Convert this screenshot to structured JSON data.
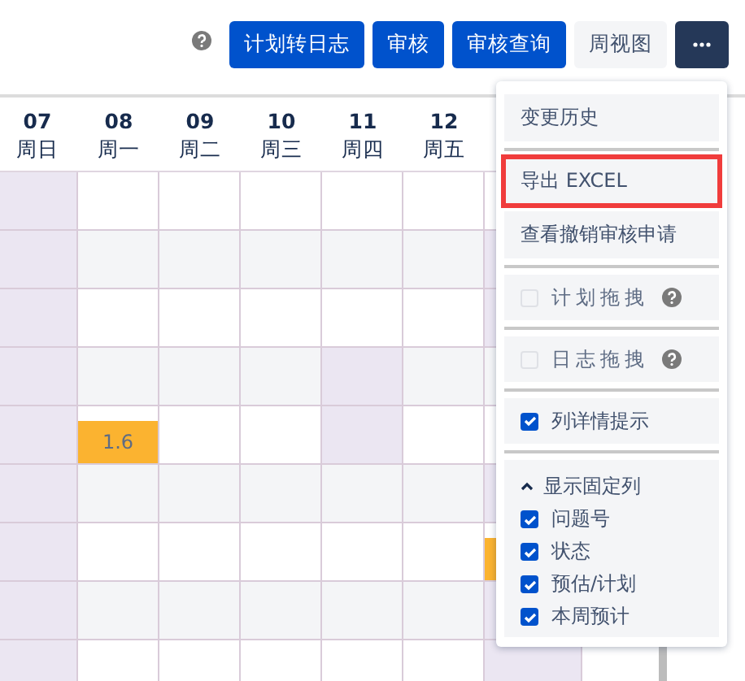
{
  "toolbar": {
    "buttons": [
      {
        "kind": "primary",
        "label": "计划转日志"
      },
      {
        "kind": "primary",
        "label": "审核"
      },
      {
        "kind": "primary",
        "label": "审核查询"
      },
      {
        "kind": "subtle",
        "label": "周视图"
      },
      {
        "kind": "more"
      }
    ]
  },
  "calendar": {
    "days": [
      {
        "date": "07",
        "weekday": "周日"
      },
      {
        "date": "08",
        "weekday": "周一"
      },
      {
        "date": "09",
        "weekday": "周二"
      },
      {
        "date": "10",
        "weekday": "周三"
      },
      {
        "date": "11",
        "weekday": "周四"
      },
      {
        "date": "12",
        "weekday": "周五"
      }
    ],
    "rows": [
      {
        "cells": [
          {
            "kind": "off"
          },
          {
            "kind": "empty"
          },
          {
            "kind": "empty"
          },
          {
            "kind": "empty"
          },
          {
            "kind": "empty"
          },
          {
            "kind": "empty"
          },
          {
            "kind": "empty"
          }
        ]
      },
      {
        "cells": [
          {
            "kind": "off"
          },
          {
            "kind": "empty"
          },
          {
            "kind": "empty"
          },
          {
            "kind": "empty"
          },
          {
            "kind": "empty"
          },
          {
            "kind": "empty"
          },
          {
            "kind": "off"
          }
        ]
      },
      {
        "cells": [
          {
            "kind": "off"
          },
          {
            "kind": "empty"
          },
          {
            "kind": "empty"
          },
          {
            "kind": "empty"
          },
          {
            "kind": "empty"
          },
          {
            "kind": "empty"
          },
          {
            "kind": "off"
          }
        ]
      },
      {
        "cells": [
          {
            "kind": "off"
          },
          {
            "kind": "empty"
          },
          {
            "kind": "empty"
          },
          {
            "kind": "empty"
          },
          {
            "kind": "off"
          },
          {
            "kind": "empty"
          },
          {
            "kind": "empty"
          }
        ]
      },
      {
        "cells": [
          {
            "kind": "off"
          },
          {
            "kind": "log",
            "text": "1.6"
          },
          {
            "kind": "empty"
          },
          {
            "kind": "empty"
          },
          {
            "kind": "off"
          },
          {
            "kind": "empty"
          },
          {
            "kind": "empty"
          }
        ]
      },
      {
        "cells": [
          {
            "kind": "off"
          },
          {
            "kind": "empty"
          },
          {
            "kind": "empty"
          },
          {
            "kind": "empty"
          },
          {
            "kind": "empty"
          },
          {
            "kind": "empty"
          },
          {
            "kind": "off"
          }
        ]
      },
      {
        "cells": [
          {
            "kind": "off"
          },
          {
            "kind": "empty"
          },
          {
            "kind": "empty"
          },
          {
            "kind": "empty"
          },
          {
            "kind": "empty"
          },
          {
            "kind": "empty"
          },
          {
            "kind": "log"
          }
        ]
      },
      {
        "cells": [
          {
            "kind": "off"
          },
          {
            "kind": "empty"
          },
          {
            "kind": "empty"
          },
          {
            "kind": "empty"
          },
          {
            "kind": "empty"
          },
          {
            "kind": "empty"
          },
          {
            "kind": "off"
          }
        ]
      },
      {
        "cells": [
          {
            "kind": "off"
          },
          {
            "kind": "empty"
          },
          {
            "kind": "empty"
          },
          {
            "kind": "empty"
          },
          {
            "kind": "empty"
          },
          {
            "kind": "empty"
          },
          {
            "kind": "off"
          }
        ]
      }
    ]
  },
  "menu": {
    "items": [
      {
        "kind": "action",
        "label": "变更历史",
        "highlighted": false
      },
      {
        "kind": "action",
        "label": "导出 EXCEL",
        "highlighted": true
      },
      {
        "kind": "action",
        "label": "查看撤销审核申请",
        "highlighted": false
      },
      {
        "kind": "toggle",
        "label": "计划拖拽",
        "checked": false,
        "help": true
      },
      {
        "kind": "toggle",
        "label": "日志拖拽",
        "checked": false,
        "help": true
      },
      {
        "kind": "toggle",
        "label": "列详情提示",
        "checked": true,
        "help": false
      },
      {
        "kind": "section",
        "label": "显示固定列",
        "expanded": true,
        "children": [
          {
            "label": "问题号",
            "checked": true
          },
          {
            "label": "状态",
            "checked": true
          },
          {
            "label": "预估/计划",
            "checked": true
          },
          {
            "label": "本周预计",
            "checked": true
          }
        ]
      }
    ]
  }
}
